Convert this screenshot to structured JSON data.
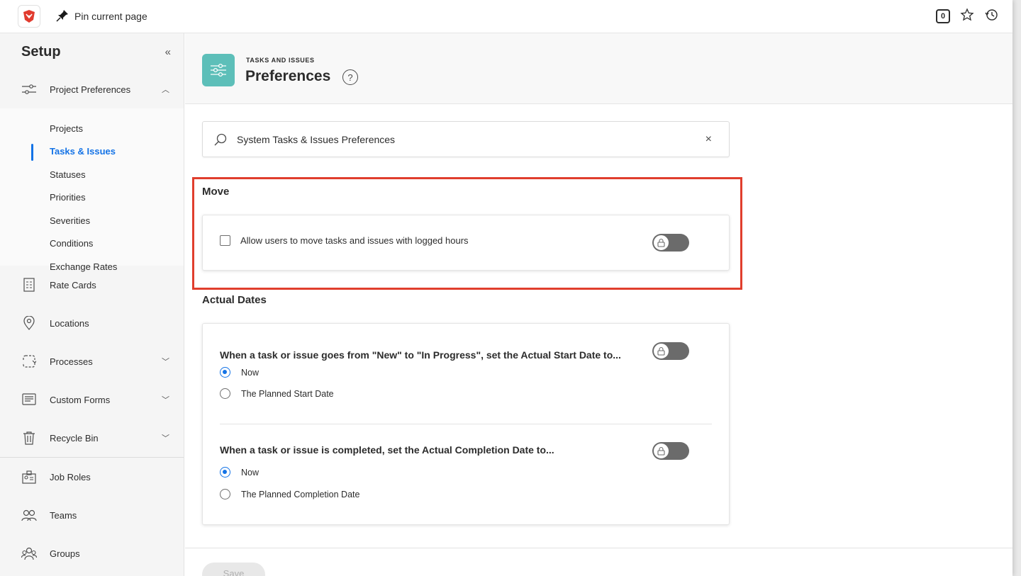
{
  "topbar": {
    "pin_label": "Pin current page",
    "badge_count": "0",
    "icons": [
      "app-logo-icon",
      "pin-icon",
      "notification-badge-icon",
      "star-icon",
      "history-icon"
    ]
  },
  "sidebar": {
    "title": "Setup",
    "collapse_label": "«",
    "section": {
      "label": "Project Preferences",
      "subitems": [
        {
          "label": "Projects",
          "active": false
        },
        {
          "label": "Tasks & Issues",
          "active": true
        },
        {
          "label": "Statuses",
          "active": false
        },
        {
          "label": "Priorities",
          "active": false
        },
        {
          "label": "Severities",
          "active": false
        },
        {
          "label": "Conditions",
          "active": false
        },
        {
          "label": "Exchange Rates",
          "active": false
        }
      ]
    },
    "items": [
      {
        "label": "Rate Cards",
        "icon": "rate-cards-icon"
      },
      {
        "label": "Locations",
        "icon": "location-pin-icon"
      },
      {
        "label": "Processes",
        "icon": "processes-icon",
        "expandable": true
      },
      {
        "label": "Custom Forms",
        "icon": "custom-forms-icon",
        "expandable": true
      },
      {
        "label": "Recycle Bin",
        "icon": "trash-icon",
        "expandable": true
      },
      {
        "label": "Job Roles",
        "icon": "job-roles-icon"
      },
      {
        "label": "Teams",
        "icon": "teams-icon"
      },
      {
        "label": "Groups",
        "icon": "groups-icon"
      }
    ]
  },
  "header": {
    "overline": "TASKS AND ISSUES",
    "title": "Preferences",
    "help": "?"
  },
  "search": {
    "value": "System Tasks & Issues Preferences",
    "clear": "×"
  },
  "sections": {
    "move": {
      "title": "Move",
      "option": "Allow users to move tasks and issues with logged hours",
      "checked": false,
      "locked": true
    },
    "actual_dates": {
      "title": "Actual Dates",
      "start": {
        "question": "When a task or issue goes from \"New\" to \"In Progress\", set the Actual Start Date to...",
        "options": [
          "Now",
          "The Planned Start Date"
        ],
        "selected": "Now"
      },
      "completion": {
        "question": "When a task or issue is completed, set the Actual Completion Date to...",
        "options": [
          "Now",
          "The Planned Completion Date"
        ],
        "selected": "Now"
      }
    }
  },
  "footer": {
    "save_label": "Save"
  },
  "colors": {
    "accent": "#1473e6",
    "highlight": "#e03e2d",
    "header_icon_bg": "#5dbfb9",
    "toggle_bg": "#6b6b6b"
  }
}
